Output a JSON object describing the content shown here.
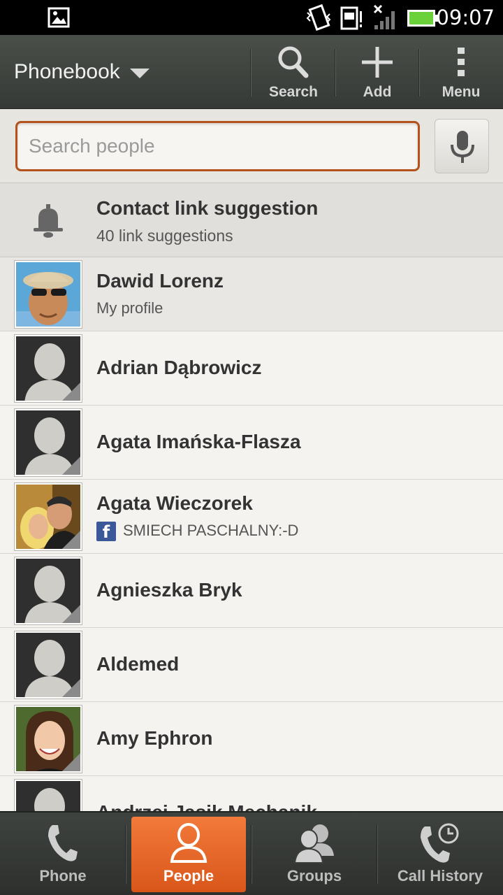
{
  "status_bar": {
    "time": "09:07",
    "icons": [
      "image-icon",
      "vibrate-icon",
      "sim-icon",
      "no-signal-icon",
      "battery-icon"
    ]
  },
  "action_bar": {
    "title": "Phonebook",
    "buttons": [
      {
        "label": "Search",
        "icon": "search-icon"
      },
      {
        "label": "Add",
        "icon": "plus-icon"
      },
      {
        "label": "Menu",
        "icon": "overflow-menu-icon"
      }
    ]
  },
  "search": {
    "placeholder": "Search people",
    "value": ""
  },
  "suggestion": {
    "title": "Contact link suggestion",
    "subtitle": "40 link suggestions"
  },
  "contacts": [
    {
      "name": "Dawid Lorenz",
      "subtitle": "My profile",
      "avatar": "photo-man-sunglasses"
    },
    {
      "name": "Adrian Dąbrowicz",
      "subtitle": "",
      "avatar": "placeholder"
    },
    {
      "name": "Agata Imańska-Flasza",
      "subtitle": "",
      "avatar": "placeholder"
    },
    {
      "name": "Agata Wieczorek",
      "subtitle": "SMIECH PASCHALNY:-D",
      "subtitle_icon": "facebook-icon",
      "avatar": "photo-couple"
    },
    {
      "name": "Agnieszka Bryk",
      "subtitle": "",
      "avatar": "placeholder"
    },
    {
      "name": "Aldemed",
      "subtitle": "",
      "avatar": "placeholder"
    },
    {
      "name": "Amy Ephron",
      "subtitle": "",
      "avatar": "photo-woman"
    },
    {
      "name": "Andrzej Jasik Mechanik",
      "subtitle": "",
      "avatar": "placeholder"
    }
  ],
  "bottom_nav": {
    "tabs": [
      {
        "label": "Phone",
        "icon": "phone-icon",
        "active": false
      },
      {
        "label": "People",
        "icon": "person-icon",
        "active": true
      },
      {
        "label": "Groups",
        "icon": "groups-icon",
        "active": false
      },
      {
        "label": "Call History",
        "icon": "call-history-icon",
        "active": false
      }
    ]
  },
  "colors": {
    "accent": "#e8652a",
    "search_border": "#b4521c",
    "facebook": "#3b5998"
  }
}
